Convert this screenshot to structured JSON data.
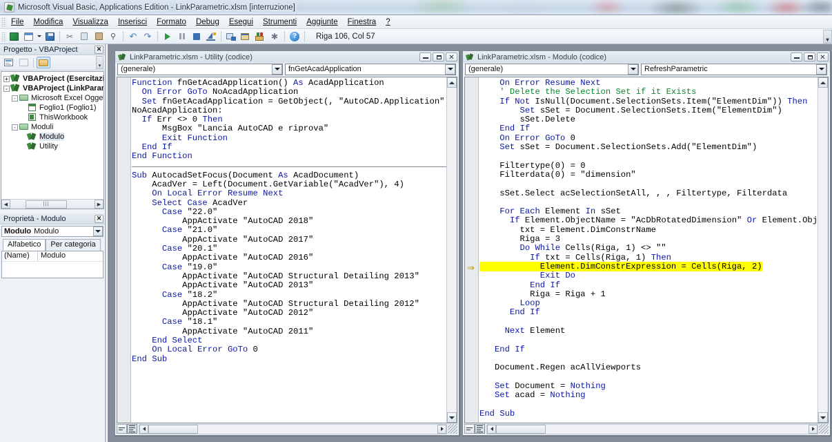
{
  "window": {
    "title": "Microsoft Visual Basic, Applications Edition - LinkParametric.xlsm [interruzione]",
    "app_icon": "vba-icon"
  },
  "menubar": {
    "items": [
      {
        "label": "File"
      },
      {
        "label": "Modifica"
      },
      {
        "label": "Visualizza"
      },
      {
        "label": "Inserisci"
      },
      {
        "label": "Formato"
      },
      {
        "label": "Debug"
      },
      {
        "label": "Esegui"
      },
      {
        "label": "Strumenti"
      },
      {
        "label": "Aggiunte"
      },
      {
        "label": "Finestra"
      },
      {
        "label": "?"
      }
    ]
  },
  "toolbar": {
    "position_label": "Riga 106, Col 57",
    "buttons": [
      {
        "name": "view-excel-icon"
      },
      {
        "name": "insert-userform-icon"
      },
      {
        "name": "insert-dropdown-icon"
      },
      {
        "name": "save-icon"
      },
      {
        "name": "cut-icon"
      },
      {
        "name": "copy-icon"
      },
      {
        "name": "paste-icon"
      },
      {
        "name": "find-icon"
      },
      {
        "name": "undo-icon"
      },
      {
        "name": "redo-icon"
      },
      {
        "name": "run-icon"
      },
      {
        "name": "break-icon"
      },
      {
        "name": "reset-icon"
      },
      {
        "name": "design-mode-icon"
      },
      {
        "name": "project-explorer-icon"
      },
      {
        "name": "properties-window-icon"
      },
      {
        "name": "object-browser-icon"
      },
      {
        "name": "toolbox-icon"
      },
      {
        "name": "help-icon"
      }
    ]
  },
  "project_pane": {
    "title": "Progetto - VBAProject",
    "close_label": "✕",
    "toolbar": [
      {
        "name": "view-code-icon"
      },
      {
        "name": "view-object-icon"
      },
      {
        "name": "toggle-folders-icon"
      }
    ],
    "tree": [
      {
        "label": "VBAProject (Esercitazion",
        "depth": 0,
        "expander": "+",
        "icon": "project-icon",
        "bold": true,
        "selected": false
      },
      {
        "label": "VBAProject (LinkParame",
        "depth": 0,
        "expander": "-",
        "icon": "project-icon",
        "bold": true,
        "selected": false
      },
      {
        "label": "Microsoft Excel Oggetti",
        "depth": 1,
        "expander": "-",
        "icon": "folder-icon",
        "bold": false,
        "selected": false
      },
      {
        "label": "Foglio1 (Foglio1)",
        "depth": 2,
        "expander": "",
        "icon": "worksheet-icon",
        "bold": false,
        "selected": false
      },
      {
        "label": "ThisWorkbook",
        "depth": 2,
        "expander": "",
        "icon": "workbook-icon",
        "bold": false,
        "selected": false
      },
      {
        "label": "Moduli",
        "depth": 1,
        "expander": "-",
        "icon": "folder-icon",
        "bold": false,
        "selected": false
      },
      {
        "label": "Modulo",
        "depth": 2,
        "expander": "",
        "icon": "module-icon",
        "bold": false,
        "selected": true
      },
      {
        "label": "Utility",
        "depth": 2,
        "expander": "",
        "icon": "module-icon",
        "bold": false,
        "selected": false
      }
    ]
  },
  "properties_pane": {
    "title": "Proprietà - Modulo",
    "close_label": "✕",
    "selector_bold": "Modulo",
    "selector_rest": "Modulo",
    "tabs": [
      {
        "label": "Alfabetico",
        "active": true
      },
      {
        "label": "Per categoria",
        "active": false
      }
    ],
    "rows": [
      {
        "key": "(Name)",
        "value": "Modulo"
      }
    ]
  },
  "code_window_left": {
    "title": "LinkParametric.xlsm - Utility (codice)",
    "object_dropdown": "(generale)",
    "proc_dropdown": "fnGetAcadApplication",
    "buttons": {
      "minimize": "minimize-icon",
      "maximize": "maximize-icon",
      "close": "close-icon"
    },
    "code_blocks": [
      [
        {
          "indent": 0,
          "tokens": [
            {
              "t": "Function",
              "c": "kw"
            },
            {
              "t": " fnGetAcadApplication() ",
              "c": ""
            },
            {
              "t": "As",
              "c": "kw"
            },
            {
              "t": " AcadApplication",
              "c": ""
            }
          ]
        },
        {
          "indent": 2,
          "tokens": [
            {
              "t": "On Error GoTo",
              "c": "kw"
            },
            {
              "t": " NoAcadApplication",
              "c": ""
            }
          ]
        },
        {
          "indent": 2,
          "tokens": [
            {
              "t": "Set",
              "c": "kw"
            },
            {
              "t": " fnGetAcadApplication = GetObject(, \"AutoCAD.Application\")",
              "c": ""
            }
          ]
        },
        {
          "indent": 0,
          "tokens": [
            {
              "t": "NoAcadApplication:",
              "c": ""
            }
          ]
        },
        {
          "indent": 2,
          "tokens": [
            {
              "t": "If",
              "c": "kw"
            },
            {
              "t": " Err <> 0 ",
              "c": ""
            },
            {
              "t": "Then",
              "c": "kw"
            }
          ]
        },
        {
          "indent": 6,
          "tokens": [
            {
              "t": "MsgBox \"Lancia AutoCAD e riprova\"",
              "c": ""
            }
          ]
        },
        {
          "indent": 6,
          "tokens": [
            {
              "t": "Exit Function",
              "c": "kw"
            }
          ]
        },
        {
          "indent": 2,
          "tokens": [
            {
              "t": "End If",
              "c": "kw"
            }
          ]
        },
        {
          "indent": 0,
          "tokens": [
            {
              "t": "End Function",
              "c": "kw"
            }
          ]
        }
      ],
      [
        {
          "indent": 0,
          "tokens": [
            {
              "t": "Sub",
              "c": "kw"
            },
            {
              "t": " AutocadSetFocus(Document ",
              "c": ""
            },
            {
              "t": "As",
              "c": "kw"
            },
            {
              "t": " AcadDocument)",
              "c": ""
            }
          ]
        },
        {
          "indent": 4,
          "tokens": [
            {
              "t": "AcadVer = Left(Document.GetVariable(\"AcadVer\"), 4)",
              "c": ""
            }
          ]
        },
        {
          "indent": 4,
          "tokens": [
            {
              "t": "On Local Error Resume Next",
              "c": "kw"
            }
          ]
        },
        {
          "indent": 4,
          "tokens": [
            {
              "t": "Select Case",
              "c": "kw"
            },
            {
              "t": " AcadVer",
              "c": ""
            }
          ]
        },
        {
          "indent": 6,
          "tokens": [
            {
              "t": "Case",
              "c": "kw"
            },
            {
              "t": " \"22.0\"",
              "c": ""
            }
          ]
        },
        {
          "indent": 10,
          "tokens": [
            {
              "t": "AppActivate \"AutoCAD 2018\"",
              "c": ""
            }
          ]
        },
        {
          "indent": 6,
          "tokens": [
            {
              "t": "Case",
              "c": "kw"
            },
            {
              "t": " \"21.0\"",
              "c": ""
            }
          ]
        },
        {
          "indent": 10,
          "tokens": [
            {
              "t": "AppActivate \"AutoCAD 2017\"",
              "c": ""
            }
          ]
        },
        {
          "indent": 6,
          "tokens": [
            {
              "t": "Case",
              "c": "kw"
            },
            {
              "t": " \"20.1\"",
              "c": ""
            }
          ]
        },
        {
          "indent": 10,
          "tokens": [
            {
              "t": "AppActivate \"AutoCAD 2016\"",
              "c": ""
            }
          ]
        },
        {
          "indent": 6,
          "tokens": [
            {
              "t": "Case",
              "c": "kw"
            },
            {
              "t": " \"19.0\"",
              "c": ""
            }
          ]
        },
        {
          "indent": 10,
          "tokens": [
            {
              "t": "AppActivate \"AutoCAD Structural Detailing 2013\"",
              "c": ""
            }
          ]
        },
        {
          "indent": 10,
          "tokens": [
            {
              "t": "AppActivate \"AutoCAD 2013\"",
              "c": ""
            }
          ]
        },
        {
          "indent": 6,
          "tokens": [
            {
              "t": "Case",
              "c": "kw"
            },
            {
              "t": " \"18.2\"",
              "c": ""
            }
          ]
        },
        {
          "indent": 10,
          "tokens": [
            {
              "t": "AppActivate \"AutoCAD Structural Detailing 2012\"",
              "c": ""
            }
          ]
        },
        {
          "indent": 10,
          "tokens": [
            {
              "t": "AppActivate \"AutoCAD 2012\"",
              "c": ""
            }
          ]
        },
        {
          "indent": 6,
          "tokens": [
            {
              "t": "Case",
              "c": "kw"
            },
            {
              "t": " \"18.1\"",
              "c": ""
            }
          ]
        },
        {
          "indent": 10,
          "tokens": [
            {
              "t": "AppActivate \"AutoCAD 2011\"",
              "c": ""
            }
          ]
        },
        {
          "indent": 4,
          "tokens": [
            {
              "t": "End Select",
              "c": "kw"
            }
          ]
        },
        {
          "indent": 4,
          "tokens": [
            {
              "t": "On Local Error GoTo",
              "c": "kw"
            },
            {
              "t": " 0",
              "c": ""
            }
          ]
        },
        {
          "indent": 0,
          "tokens": [
            {
              "t": "End Sub",
              "c": "kw"
            }
          ]
        }
      ]
    ]
  },
  "code_window_right": {
    "title": "LinkParametric.xlsm - Modulo (codice)",
    "object_dropdown": "(generale)",
    "proc_dropdown": "RefreshParametric",
    "buttons": {
      "minimize": "minimize-icon",
      "maximize": "maximize-icon",
      "close": "close-icon"
    },
    "execution_marker": "⇒",
    "highlight_color": "#ffff00",
    "code_blocks": [
      [
        {
          "indent": 4,
          "tokens": [
            {
              "t": "On Error Resume Next",
              "c": "kw"
            }
          ]
        },
        {
          "indent": 4,
          "tokens": [
            {
              "t": "' Delete the Selection Set if it Exists",
              "c": "cm"
            }
          ]
        },
        {
          "indent": 4,
          "tokens": [
            {
              "t": "If Not",
              "c": "kw"
            },
            {
              "t": " IsNull(Document.SelectionSets.Item(\"ElementDim\")) ",
              "c": ""
            },
            {
              "t": "Then",
              "c": "kw"
            }
          ]
        },
        {
          "indent": 8,
          "tokens": [
            {
              "t": "Set",
              "c": "kw"
            },
            {
              "t": " sSet = Document.SelectionSets.Item(\"ElementDim\")",
              "c": ""
            }
          ]
        },
        {
          "indent": 8,
          "tokens": [
            {
              "t": "sSet.Delete",
              "c": ""
            }
          ]
        },
        {
          "indent": 4,
          "tokens": [
            {
              "t": "End If",
              "c": "kw"
            }
          ]
        },
        {
          "indent": 4,
          "tokens": [
            {
              "t": "On Error GoTo",
              "c": "kw"
            },
            {
              "t": " 0",
              "c": ""
            }
          ]
        },
        {
          "indent": 4,
          "tokens": [
            {
              "t": "Set",
              "c": "kw"
            },
            {
              "t": " sSet = Document.SelectionSets.Add(\"ElementDim\")",
              "c": ""
            }
          ]
        },
        {
          "indent": 0,
          "tokens": []
        },
        {
          "indent": 4,
          "tokens": [
            {
              "t": "Filtertype(0) = 0",
              "c": ""
            }
          ]
        },
        {
          "indent": 4,
          "tokens": [
            {
              "t": "Filterdata(0) = \"dimension\"",
              "c": ""
            }
          ]
        },
        {
          "indent": 0,
          "tokens": []
        },
        {
          "indent": 4,
          "tokens": [
            {
              "t": "sSet.Select acSelectionSetAll, , , Filtertype, Filterdata",
              "c": ""
            }
          ]
        },
        {
          "indent": 0,
          "tokens": []
        },
        {
          "indent": 4,
          "tokens": [
            {
              "t": "For Each",
              "c": "kw"
            },
            {
              "t": " Element ",
              "c": ""
            },
            {
              "t": "In",
              "c": "kw"
            },
            {
              "t": " sSet",
              "c": ""
            }
          ]
        },
        {
          "indent": 6,
          "tokens": [
            {
              "t": "If",
              "c": "kw"
            },
            {
              "t": " Element.ObjectName = \"AcDbRotatedDimension\" ",
              "c": ""
            },
            {
              "t": "Or",
              "c": "kw"
            },
            {
              "t": " Element.ObjectNam",
              "c": ""
            }
          ]
        },
        {
          "indent": 8,
          "tokens": [
            {
              "t": "txt = Element.DimConstrName",
              "c": ""
            }
          ]
        },
        {
          "indent": 8,
          "tokens": [
            {
              "t": "Riga = 3",
              "c": ""
            }
          ]
        },
        {
          "indent": 8,
          "tokens": [
            {
              "t": "Do While",
              "c": "kw"
            },
            {
              "t": " Cells(Riga, 1) <> \"\"",
              "c": ""
            }
          ]
        },
        {
          "indent": 10,
          "tokens": [
            {
              "t": "If",
              "c": "kw"
            },
            {
              "t": " txt = Cells(Riga, 1) ",
              "c": ""
            },
            {
              "t": "Then",
              "c": "kw"
            }
          ]
        },
        {
          "indent": 12,
          "highlight": true,
          "tokens": [
            {
              "t": "Element.DimConstrExpression = Cells(Riga, 2)",
              "c": ""
            }
          ]
        },
        {
          "indent": 12,
          "tokens": [
            {
              "t": "Exit Do",
              "c": "kw"
            }
          ]
        },
        {
          "indent": 10,
          "tokens": [
            {
              "t": "End If",
              "c": "kw"
            }
          ]
        },
        {
          "indent": 10,
          "tokens": [
            {
              "t": "Riga = Riga + 1",
              "c": ""
            }
          ]
        },
        {
          "indent": 8,
          "tokens": [
            {
              "t": "Loop",
              "c": "kw"
            }
          ]
        },
        {
          "indent": 6,
          "tokens": [
            {
              "t": "End If",
              "c": "kw"
            }
          ]
        },
        {
          "indent": 0,
          "tokens": []
        },
        {
          "indent": 5,
          "tokens": [
            {
              "t": "Next",
              "c": "kw"
            },
            {
              "t": " Element",
              "c": ""
            }
          ]
        },
        {
          "indent": 0,
          "tokens": []
        },
        {
          "indent": 3,
          "tokens": [
            {
              "t": "End If",
              "c": "kw"
            }
          ]
        },
        {
          "indent": 0,
          "tokens": []
        },
        {
          "indent": 3,
          "tokens": [
            {
              "t": "Document.Regen acAllViewports",
              "c": ""
            }
          ]
        },
        {
          "indent": 0,
          "tokens": []
        },
        {
          "indent": 3,
          "tokens": [
            {
              "t": "Set",
              "c": "kw"
            },
            {
              "t": " Document = ",
              "c": ""
            },
            {
              "t": "Nothing",
              "c": "kw"
            }
          ]
        },
        {
          "indent": 3,
          "tokens": [
            {
              "t": "Set",
              "c": "kw"
            },
            {
              "t": " acad = ",
              "c": ""
            },
            {
              "t": "Nothing",
              "c": "kw"
            }
          ]
        },
        {
          "indent": 0,
          "tokens": []
        },
        {
          "indent": 0,
          "tokens": [
            {
              "t": "End Sub",
              "c": "kw"
            }
          ]
        }
      ]
    ]
  },
  "colors": {
    "keyword": "#0b17a6",
    "comment": "#0a8a2e",
    "highlight": "#ffff00",
    "mdi_background": "#848d99"
  }
}
